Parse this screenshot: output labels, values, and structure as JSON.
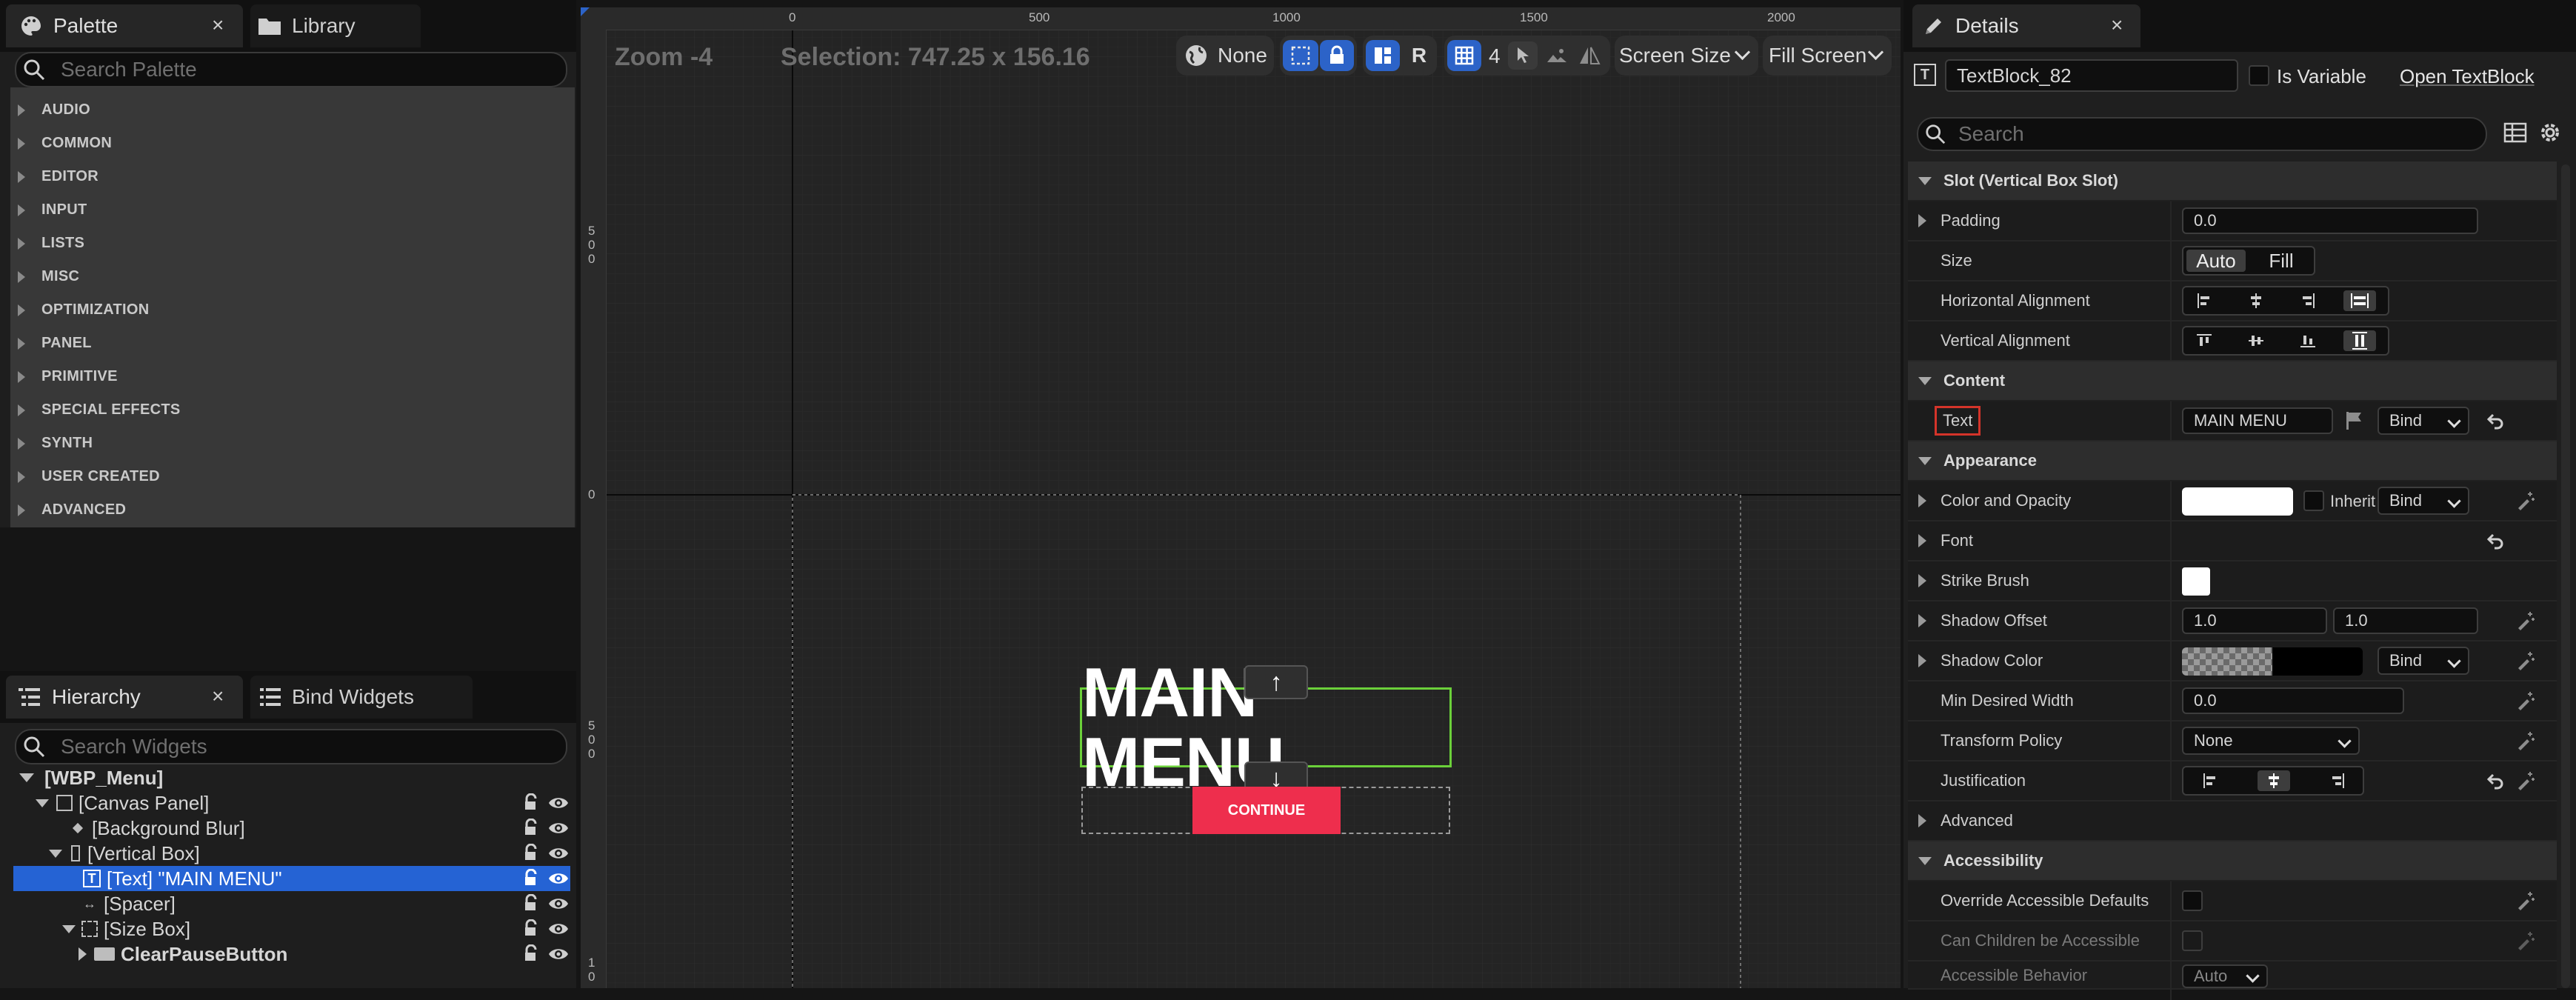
{
  "palette": {
    "tab_label": "Palette",
    "library_label": "Library",
    "search_placeholder": "Search Palette",
    "categories": [
      "AUDIO",
      "COMMON",
      "EDITOR",
      "INPUT",
      "LISTS",
      "MISC",
      "OPTIMIZATION",
      "PANEL",
      "PRIMITIVE",
      "SPECIAL EFFECTS",
      "SYNTH",
      "USER CREATED",
      "ADVANCED"
    ]
  },
  "hierarchy": {
    "tab_label": "Hierarchy",
    "bind_widgets_label": "Bind Widgets",
    "search_placeholder": "Search Widgets",
    "items": [
      {
        "label": "[WBP_Menu]"
      },
      {
        "label": "[Canvas Panel]"
      },
      {
        "label": "[Background Blur]"
      },
      {
        "label": "[Vertical Box]"
      },
      {
        "label": "[Text] \"MAIN MENU\""
      },
      {
        "label": "[Spacer]"
      },
      {
        "label": "[Size Box]"
      },
      {
        "label": "ClearPauseButton"
      }
    ]
  },
  "canvas": {
    "zoom": "Zoom -4",
    "selection": "Selection: 747.25 x 156.16",
    "none_label": "None",
    "grid_snap": "4",
    "r_label": "R",
    "screen_size_label": "Screen Size",
    "fill_screen_label": "Fill Screen",
    "ruler_top": [
      "0",
      "500",
      "1000",
      "1500",
      "2000"
    ],
    "ruler_left": [
      "5\n0\n0",
      "0",
      "5\n0\n0",
      "1\n0"
    ],
    "main_text": "MAIN MENU",
    "button_text": "CONTINUE",
    "accent_button_color": "#ee2e4d",
    "selection_outline_color": "#6bd03a"
  },
  "details": {
    "tab_label": "Details",
    "widget_name": "TextBlock_82",
    "is_variable_label": "Is Variable",
    "open_link": "Open TextBlock",
    "search_placeholder": "Search",
    "sections": {
      "slot": "Slot (Vertical Box Slot)",
      "content": "Content",
      "appearance": "Appearance",
      "accessibility": "Accessibility"
    },
    "rows": {
      "padding": {
        "label": "Padding",
        "value": "0.0"
      },
      "size": {
        "label": "Size",
        "auto": "Auto",
        "fill": "Fill"
      },
      "halign": {
        "label": "Horizontal Alignment"
      },
      "valign": {
        "label": "Vertical Alignment"
      },
      "text": {
        "label": "Text",
        "value": "MAIN MENU",
        "bind": "Bind"
      },
      "color": {
        "label": "Color and Opacity",
        "inherit": "Inherit",
        "bind": "Bind"
      },
      "font": {
        "label": "Font"
      },
      "strike": {
        "label": "Strike Brush"
      },
      "shadow_offset": {
        "label": "Shadow Offset",
        "x": "1.0",
        "y": "1.0"
      },
      "shadow_color": {
        "label": "Shadow Color",
        "bind": "Bind"
      },
      "min_width": {
        "label": "Min Desired Width",
        "value": "0.0"
      },
      "transform": {
        "label": "Transform Policy",
        "value": "None"
      },
      "justification": {
        "label": "Justification"
      },
      "advanced": {
        "label": "Advanced"
      },
      "override": {
        "label": "Override Accessible Defaults"
      },
      "children": {
        "label": "Can Children be Accessible"
      },
      "behavior": {
        "label": "Accessible Behavior",
        "value": "Auto"
      }
    }
  }
}
